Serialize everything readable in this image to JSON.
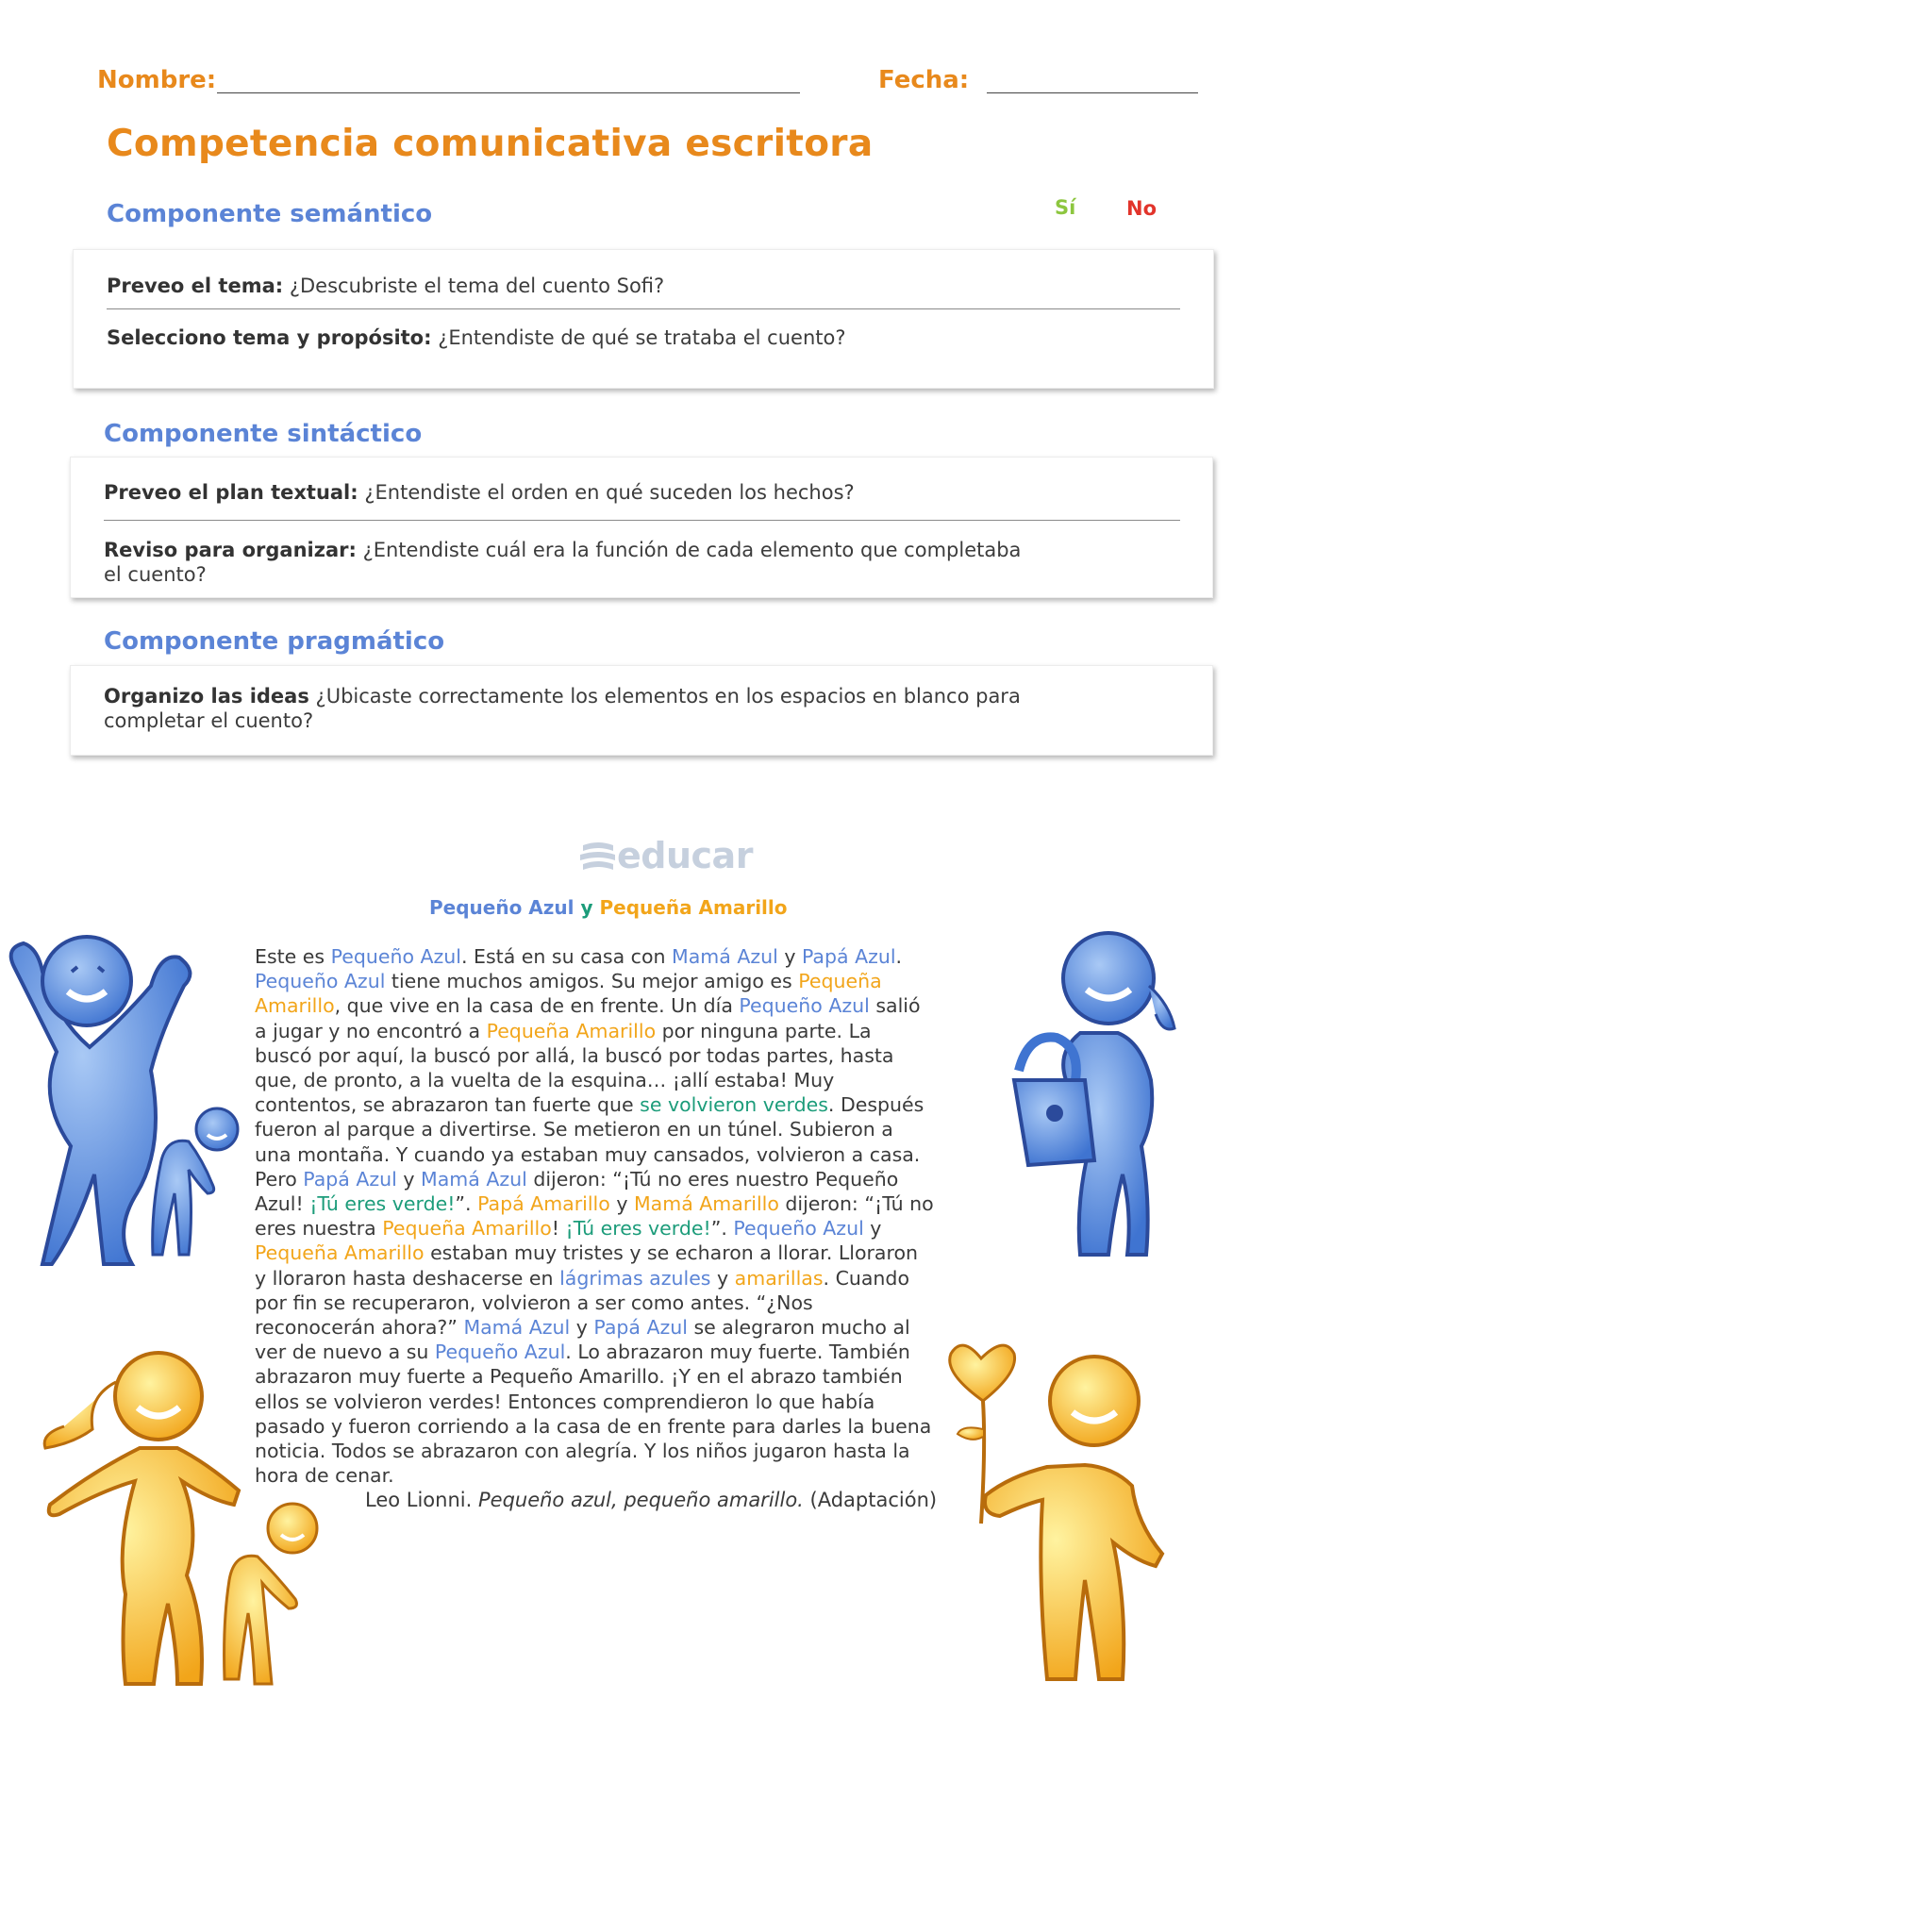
{
  "header": {
    "name_label": "Nombre:",
    "date_label": "Fecha:"
  },
  "title": "Competencia comunicativa escritora",
  "columns": {
    "si": "Sí",
    "no": "No"
  },
  "sections": [
    {
      "title": "Componente semántico",
      "items": [
        {
          "bold": "Preveo el tema:",
          "text": "¿Descubriste el tema del cuento Sofi?"
        },
        {
          "bold": "Selecciono tema y propósito:",
          "text": "¿Entendiste de qué se trataba el cuento?"
        }
      ]
    },
    {
      "title": "Componente sintáctico",
      "items": [
        {
          "bold": "Preveo el plan textual:",
          "text": "¿Entendiste el orden en qué suceden los hechos?"
        },
        {
          "bold": "Reviso para organizar:",
          "text": "¿Entendiste cuál era la función de cada elemento que completaba el cuento?"
        }
      ]
    },
    {
      "title": "Componente pragmático",
      "items": [
        {
          "bold": "Organizo las ideas",
          "text": "¿Ubicaste correctamente los elementos en los espacios en blanco para completar el cuento?"
        }
      ]
    }
  ],
  "logo": "educar",
  "story": {
    "title_a": "Pequeño Azul",
    "title_y": "y",
    "title_b": "Pequeña Amarillo",
    "segments": [
      [
        "Este es ",
        ""
      ],
      [
        "Pequeño Azul",
        "blue"
      ],
      [
        ". Está en su casa con ",
        ""
      ],
      [
        "Mamá Azul",
        "blue"
      ],
      [
        " y ",
        ""
      ],
      [
        "Papá Azul",
        "blue"
      ],
      [
        ". ",
        ""
      ],
      [
        "Pequeño Azul",
        "blue"
      ],
      [
        " tiene muchos amigos. Su mejor amigo es ",
        ""
      ],
      [
        "Pequeña Amarillo",
        "yel"
      ],
      [
        ", que vive en la casa de en frente. Un día ",
        ""
      ],
      [
        "Pequeño Azul",
        "blue"
      ],
      [
        " salió a jugar y no encontró a ",
        ""
      ],
      [
        "Pequeña Amarillo",
        "yel"
      ],
      [
        " por ninguna parte. La buscó por aquí, la buscó por allá, la buscó por todas partes, hasta que, de pronto, a la vuelta de la esquina… ¡allí estaba! Muy contentos, se abrazaron tan fuerte que ",
        ""
      ],
      [
        "se volvieron verdes",
        "grn"
      ],
      [
        ". Después fueron al parque a divertirse. Se metieron en un túnel. Subieron a una montaña. Y cuando ya estaban muy cansados, volvieron a casa. Pero ",
        ""
      ],
      [
        "Papá Azul",
        "blue"
      ],
      [
        " y ",
        ""
      ],
      [
        "Mamá Azul",
        "blue"
      ],
      [
        " dijeron: “¡Tú no eres nuestro Pequeño Azul! ",
        ""
      ],
      [
        "¡Tú eres verde!",
        "grn"
      ],
      [
        "”. ",
        ""
      ],
      [
        "Papá Amarillo",
        "yel"
      ],
      [
        " y ",
        ""
      ],
      [
        "Mamá Amarillo",
        "yel"
      ],
      [
        " dijeron: “¡Tú no eres nuestra ",
        ""
      ],
      [
        "Pequeña Amarillo",
        "yel"
      ],
      [
        "! ",
        ""
      ],
      [
        "¡Tú eres verde!",
        "grn"
      ],
      [
        "”. ",
        ""
      ],
      [
        "Pequeño Azul",
        "blue"
      ],
      [
        " y ",
        ""
      ],
      [
        "Pequeña Amarillo",
        "yel"
      ],
      [
        " estaban muy tristes y se echaron a llorar. Lloraron y lloraron hasta deshacerse en ",
        ""
      ],
      [
        "lágrimas azules",
        "blue"
      ],
      [
        " y ",
        ""
      ],
      [
        "amarillas",
        "yel"
      ],
      [
        ". Cuando por fin se recuperaron, volvieron a ser como antes. “¿Nos reconocerán ahora?” ",
        ""
      ],
      [
        "Mamá Azul",
        "blue"
      ],
      [
        " y ",
        ""
      ],
      [
        "Papá Azul",
        "blue"
      ],
      [
        " se alegraron mucho al ver de nuevo a su ",
        ""
      ],
      [
        "Pequeño Azul",
        "blue"
      ],
      [
        ". Lo abrazaron muy fuerte. También abrazaron muy fuerte a Pequeño Amarillo. ¡Y en el abrazo también ellos se volvieron verdes! Entonces comprendieron lo que había pasado y fueron corriendo a la casa de en frente para darles la buena noticia. Todos se abrazaron con alegría. Y los niños jugaron hasta la hora de cenar.",
        ""
      ]
    ],
    "credit_author": "Leo Lionni.",
    "credit_work": "Pequeño azul, pequeño amarillo.",
    "credit_note": "(Adaptación)"
  },
  "colors": {
    "orange": "#e8891c",
    "blue": "#5b84d6",
    "yellow": "#f2a51a",
    "green": "#1c9c7a",
    "si": "#8dc63f",
    "no": "#e2342b"
  }
}
